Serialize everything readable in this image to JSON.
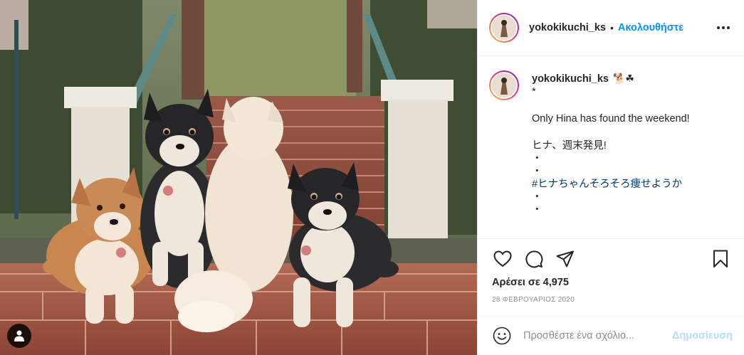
{
  "photo": {
    "description_icon": "user-tag-icon"
  },
  "header": {
    "username": "yokokikuchi_ks",
    "separator": "•",
    "follow_label": "Ακολουθήστε",
    "more_icon": "more-options-icon"
  },
  "caption": {
    "username": "yokokikuchi_ks",
    "emojis": "🐕☘",
    "lines": {
      "l1": "*",
      "l2": "Only Hina has found the weekend!",
      "l3": "ヒナ、週末発見!",
      "l4": "・",
      "l5": "・",
      "hashtag": "#ヒナちゃんそろそろ痩せようか",
      "l6": "・",
      "l7": "・"
    }
  },
  "actions": {
    "like_icon": "heart-icon",
    "comment_icon": "comment-icon",
    "share_icon": "share-icon",
    "save_icon": "bookmark-icon"
  },
  "likes": "Αρέσει σε 4,975",
  "date": "28 ΦΕΒΡΟΥΑΡΙΟΣ 2020",
  "comment": {
    "placeholder": "Προσθέστε ένα σχόλιο...",
    "post_label": "Δημοσίευση",
    "emoji_icon": "smiley-icon"
  },
  "colors": {
    "accent": "#0095f6",
    "post_disabled": "#b2dffc",
    "hashtag": "#00376b",
    "muted": "#8e8e8e"
  }
}
